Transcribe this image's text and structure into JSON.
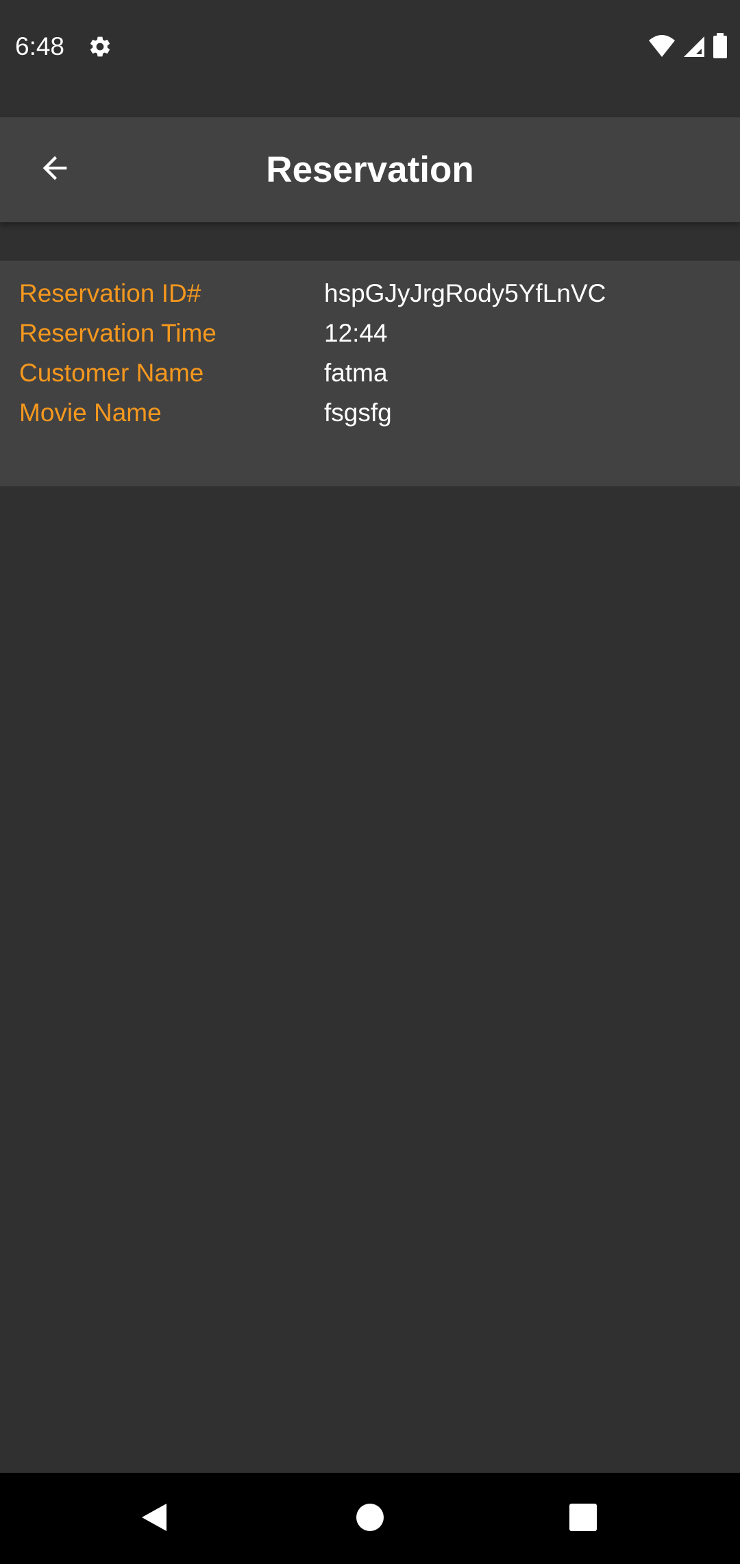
{
  "status_bar": {
    "time": "6:48",
    "icons": [
      "gear-icon",
      "wifi-icon",
      "cell-signal-icon",
      "battery-icon"
    ]
  },
  "toolbar": {
    "title": "Reservation",
    "back_icon": "arrow-back-icon"
  },
  "details": {
    "rows": [
      {
        "label": "Reservation ID#",
        "value": "hspGJyJrgRody5YfLnVC"
      },
      {
        "label": "Reservation Time",
        "value": "12:44"
      },
      {
        "label": "Customer Name",
        "value": "fatma"
      },
      {
        "label": "Movie Name",
        "value": "fsgsfg"
      }
    ]
  },
  "nav_bar": {
    "icons": [
      "nav-back-icon",
      "nav-home-icon",
      "nav-recents-icon"
    ]
  },
  "colors": {
    "background": "#303030",
    "surface": "#424242",
    "accent": "#F5981E",
    "text": "#FFFFFF",
    "nav_bar": "#000000"
  }
}
